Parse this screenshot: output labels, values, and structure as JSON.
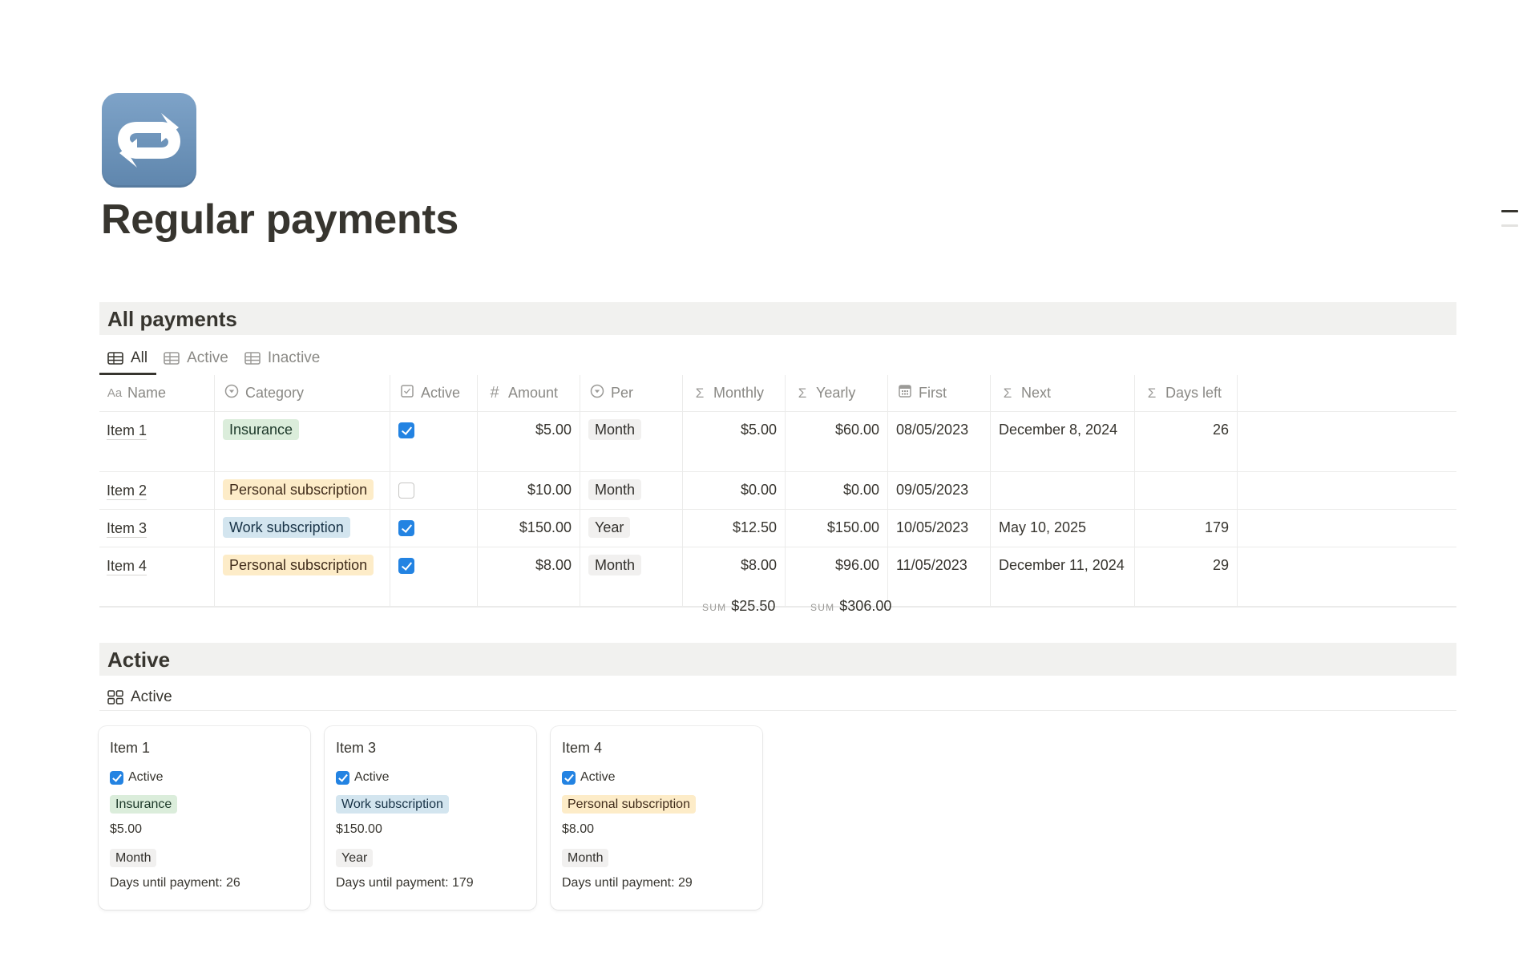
{
  "page": {
    "icon": "repeat-icon",
    "title": "Regular payments"
  },
  "toc": {
    "items": [
      "Regular payments",
      "All payments"
    ]
  },
  "all_payments": {
    "heading": "All payments",
    "tabs": [
      {
        "label": "All",
        "icon": "table-icon",
        "active": true
      },
      {
        "label": "Active",
        "icon": "table-icon",
        "active": false
      },
      {
        "label": "Inactive",
        "icon": "table-icon",
        "active": false
      }
    ],
    "columns": [
      {
        "label": "Name",
        "icon": "Aa"
      },
      {
        "label": "Category",
        "icon": "select-icon"
      },
      {
        "label": "Active",
        "icon": "checkbox-icon"
      },
      {
        "label": "Amount",
        "icon": "#"
      },
      {
        "label": "Per",
        "icon": "select-icon"
      },
      {
        "label": "Monthly",
        "icon": "Σ"
      },
      {
        "label": "Yearly",
        "icon": "Σ"
      },
      {
        "label": "First",
        "icon": "calendar-icon"
      },
      {
        "label": "Next",
        "icon": "Σ"
      },
      {
        "label": "Days left",
        "icon": "Σ"
      }
    ],
    "rows": [
      {
        "name": "Item 1",
        "category": "Insurance",
        "category_color": "green",
        "active": true,
        "amount": "$5.00",
        "per": "Month",
        "monthly": "$5.00",
        "yearly": "$60.00",
        "first": "08/05/2023",
        "next": "December 8, 2024",
        "days_left": "26"
      },
      {
        "name": "Item 2",
        "category": "Personal subscription",
        "category_color": "orange",
        "active": false,
        "amount": "$10.00",
        "per": "Month",
        "monthly": "$0.00",
        "yearly": "$0.00",
        "first": "09/05/2023",
        "next": "",
        "days_left": ""
      },
      {
        "name": "Item 3",
        "category": "Work subscription",
        "category_color": "blue",
        "active": true,
        "amount": "$150.00",
        "per": "Year",
        "monthly": "$12.50",
        "yearly": "$150.00",
        "first": "10/05/2023",
        "next": "May 10, 2025",
        "days_left": "179"
      },
      {
        "name": "Item 4",
        "category": "Personal subscription",
        "category_color": "orange",
        "active": true,
        "amount": "$8.00",
        "per": "Month",
        "monthly": "$8.00",
        "yearly": "$96.00",
        "first": "11/05/2023",
        "next": "December 11, 2024",
        "days_left": "29"
      }
    ],
    "sums": {
      "monthly": {
        "label": "SUM",
        "value": "$25.50"
      },
      "yearly": {
        "label": "SUM",
        "value": "$306.00"
      }
    }
  },
  "active_section": {
    "heading": "Active",
    "view_tab": {
      "label": "Active",
      "icon": "gallery-icon"
    },
    "cards": [
      {
        "title": "Item 1",
        "active_label": "Active",
        "active": true,
        "category": "Insurance",
        "category_color": "green",
        "amount": "$5.00",
        "per": "Month",
        "days": "Days until payment: 26"
      },
      {
        "title": "Item 3",
        "active_label": "Active",
        "active": true,
        "category": "Work subscription",
        "category_color": "blue",
        "amount": "$150.00",
        "per": "Year",
        "days": "Days until payment: 179"
      },
      {
        "title": "Item 4",
        "active_label": "Active",
        "active": true,
        "category": "Personal subscription",
        "category_color": "orange",
        "amount": "$8.00",
        "per": "Month",
        "days": "Days until payment: 29"
      }
    ]
  },
  "colors": {
    "checkbox_on": "#2383e2",
    "tag_green": "#dbeddb",
    "tag_orange": "#fdecc8",
    "tag_blue": "#d3e5ef",
    "tag_gray": "#f1f0ef",
    "section_band": "#f1f1ef"
  }
}
